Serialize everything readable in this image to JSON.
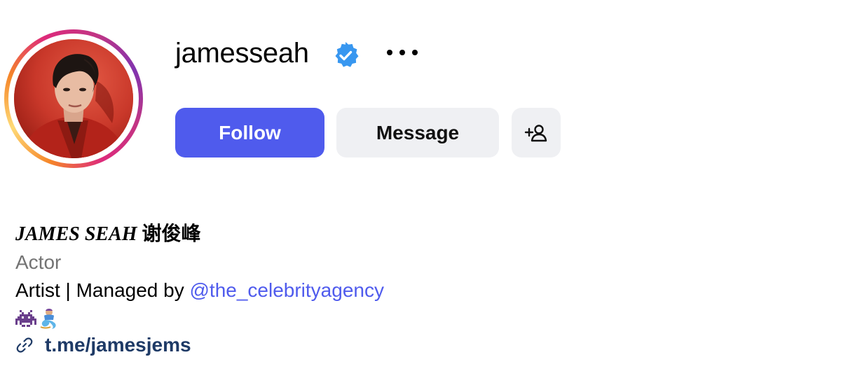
{
  "profile": {
    "username": "jamesseah",
    "verified": true,
    "avatar_alt": "profile photo of jamesseah"
  },
  "actions": {
    "follow_label": "Follow",
    "message_label": "Message",
    "more_icon": "ellipsis-icon",
    "suggest_icon": "add-person-icon"
  },
  "bio": {
    "name_latin": "JAMES SEAH",
    "name_chinese": "谢俊峰",
    "category": "Actor",
    "description_prefix": "Artist | Managed by ",
    "mention": "@the_celebrityagency",
    "emojis": [
      "alien-monster-emoji",
      "genie-emoji"
    ],
    "link": "t.me/jamesjems"
  },
  "colors": {
    "accent": "#4f5bed",
    "secondary_button": "#eff0f3",
    "verified_badge": "#3897f0",
    "category_text": "#737373",
    "link_text": "#1e3a66"
  }
}
